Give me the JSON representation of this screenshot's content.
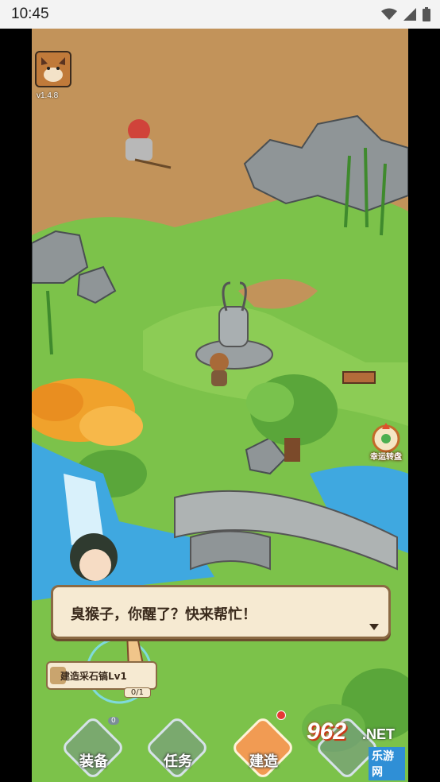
{
  "status_bar": {
    "time": "10:45"
  },
  "game": {
    "version": "v1.4.8",
    "lucky_wheel_label": "幸运转盘",
    "dialog_text": "臭猴子，你醒了？快来帮忙！",
    "quest": {
      "title": "建造采石镐Lv1",
      "progress": "0/1"
    },
    "bottom_menu": [
      {
        "label": "装备",
        "badge": "0"
      },
      {
        "label": "任务"
      },
      {
        "label": "建造"
      },
      {
        "label": ""
      }
    ]
  },
  "watermark": {
    "number": "962",
    "suffix": ".NET",
    "site_cn": "乐游网"
  },
  "colors": {
    "dirt": "#c2935a",
    "grass": "#7cc24a",
    "water": "#3fa8e0",
    "stone": "#9aa0a2",
    "dialog_bg": "#f6ead2",
    "accent_orange": "#f19b53"
  }
}
